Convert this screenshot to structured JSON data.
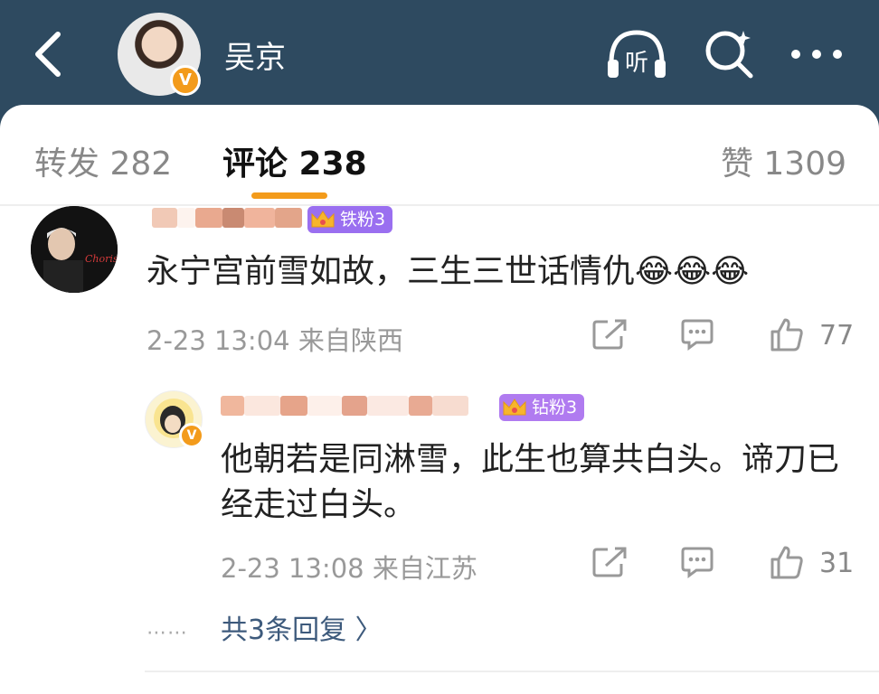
{
  "header": {
    "title": "吴京",
    "verified_badge": "V",
    "listen_label": "听"
  },
  "tabs": [
    {
      "label": "转发 282"
    },
    {
      "label": "评论 238"
    },
    {
      "label": "赞 1309"
    }
  ],
  "comment": {
    "badge": "铁粉3",
    "text": "永宁宫前雪如故，三生三世话情仇😂😂😂",
    "meta": "2-23 13:04 来自陕西",
    "like_count": "77",
    "avatar_text": "Choristes"
  },
  "reply": {
    "badge": "钻粉3",
    "text": "他朝若是同淋雪，此生也算共白头。谛刀已经走过白头。",
    "meta": "2-23 13:08 来自江苏",
    "like_count": "31",
    "verified_badge": "V"
  },
  "more_replies": {
    "dots": "⋯⋯",
    "label": "共3条回复 〉"
  },
  "colors": {
    "header_bg": "#2e4a60",
    "accent": "#f39b1b",
    "link": "#3d5a7c"
  }
}
